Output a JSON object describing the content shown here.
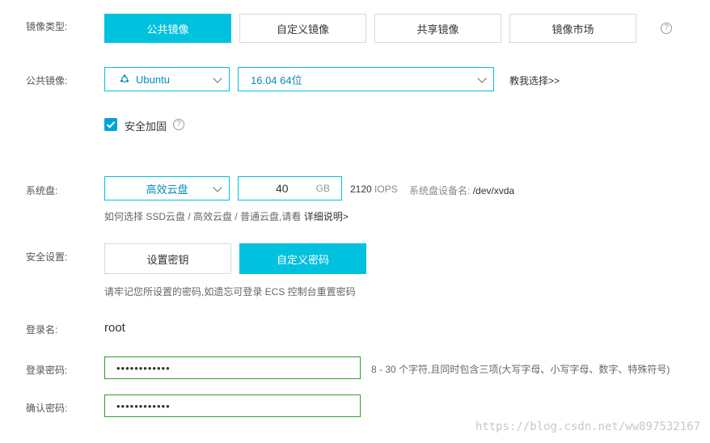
{
  "image_type": {
    "label": "镜像类型:",
    "tabs": [
      "公共镜像",
      "自定义镜像",
      "共享镜像",
      "镜像市场"
    ],
    "active_index": 0
  },
  "public_image": {
    "label": "公共镜像:",
    "os_value": "Ubuntu",
    "version_value": "16.04 64位",
    "help_link": "教我选择>>"
  },
  "security_hardening": {
    "label": "安全加固",
    "checked": true
  },
  "system_disk": {
    "label": "系统盘:",
    "type_value": "高效云盘",
    "size_value": "40",
    "unit": "GB",
    "iops_value": "2120",
    "iops_unit": "IOPS",
    "device_label": "系统盘设备名:",
    "device_value": "/dev/xvda",
    "hint_prefix": "如何选择 SSD云盘 / 高效云盘 / 普通云盘,请看",
    "hint_link": "详细说明>"
  },
  "security_settings": {
    "label": "安全设置:",
    "options": [
      "设置密钥",
      "自定义密码"
    ],
    "active_index": 1,
    "hint": "请牢记您所设置的密码,如遗忘可登录 ECS 控制台重置密码"
  },
  "login_name": {
    "label": "登录名:",
    "value": "root"
  },
  "login_password": {
    "label": "登录密码:",
    "masked_value": "••••••••••••",
    "hint": "8 - 30 个字符,且同时包含三项(大写字母、小写字母、数字、特殊符号)"
  },
  "confirm_password": {
    "label": "确认密码:",
    "masked_value": "••••••••••••"
  },
  "watermark": "https://blog.csdn.net/ww897532167",
  "colors": {
    "accent": "#00c1de",
    "valid_border": "#2e9e2e"
  }
}
